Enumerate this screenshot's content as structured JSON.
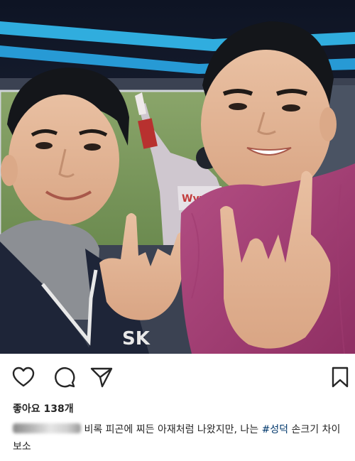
{
  "post": {
    "image": {
      "description": "",
      "jersey_text": "SK",
      "screen_text": "Wyvern"
    },
    "likes_text": "좋아요 138개",
    "caption": {
      "username": "",
      "text_before": " 비록 피곤에 찌든 아재처럼 나왔지만, 나는 ",
      "hashtag": "#성덕",
      "text_after": " 손크기 차이보소"
    },
    "icons": {
      "like": "heart-icon",
      "comment": "comment-icon",
      "share": "paper-plane-icon",
      "bookmark": "bookmark-icon"
    },
    "colors": {
      "text": "#262626",
      "hashtag": "#00376b",
      "icon": "#262626"
    }
  }
}
